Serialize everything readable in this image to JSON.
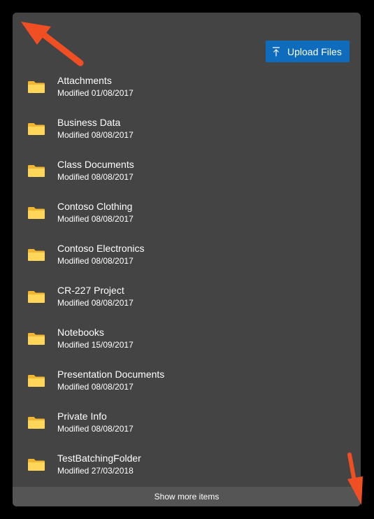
{
  "toolbar": {
    "upload_label": "Upload Files"
  },
  "folders": [
    {
      "name": "Attachments",
      "modified": "Modified 01/08/2017"
    },
    {
      "name": "Business Data",
      "modified": "Modified 08/08/2017"
    },
    {
      "name": "Class Documents",
      "modified": "Modified 08/08/2017"
    },
    {
      "name": "Contoso Clothing",
      "modified": "Modified 08/08/2017"
    },
    {
      "name": "Contoso Electronics",
      "modified": "Modified 08/08/2017"
    },
    {
      "name": "CR-227 Project",
      "modified": "Modified 08/08/2017"
    },
    {
      "name": "Notebooks",
      "modified": "Modified 15/09/2017"
    },
    {
      "name": "Presentation Documents",
      "modified": "Modified 08/08/2017"
    },
    {
      "name": "Private Info",
      "modified": "Modified 08/08/2017"
    },
    {
      "name": "TestBatchingFolder",
      "modified": "Modified 27/03/2018"
    }
  ],
  "footer": {
    "show_more_label": "Show more items"
  },
  "colors": {
    "accent": "#0f6cbd",
    "panel": "#444444",
    "folder": "#f7c948",
    "annotation_arrow": "#f04e23"
  },
  "icons": {
    "upload": "arrow-up-to-line-icon",
    "folder": "folder-icon",
    "annotation": "arrow-icon"
  }
}
